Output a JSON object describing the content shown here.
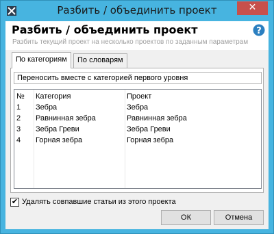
{
  "window": {
    "title": "Разбить / объединить проект",
    "close_glyph": "✕"
  },
  "header": {
    "heading": "Разбить / объединить проект",
    "subheading": "Разбить текущий проект на несколько проектов по заданным параметрам"
  },
  "tabs": [
    {
      "label": "По категориям",
      "active": true
    },
    {
      "label": "По словарям",
      "active": false
    }
  ],
  "group": {
    "label": "Переносить вместе с категорией первого уровня"
  },
  "grid": {
    "columns": [
      "№",
      "Категория",
      "Проект"
    ],
    "rows": [
      [
        "1",
        "Зебра",
        "Зебра"
      ],
      [
        "2",
        "Равнинная зебра",
        "Равнинная зебра"
      ],
      [
        "3",
        "Зебра Греви",
        "Зебра Греви"
      ],
      [
        "4",
        "Горная зебра",
        "Горная зебра"
      ]
    ]
  },
  "options": {
    "delete_matched_label": "Удалять совпавшие статьи из этого проекта",
    "delete_matched_checked": true,
    "check_glyph": "✔"
  },
  "buttons": {
    "ok": "ОК",
    "cancel": "Отмена"
  },
  "colors": {
    "titlebar": "#47b4e0",
    "close": "#c7504b",
    "help": "#2b7fc0"
  }
}
